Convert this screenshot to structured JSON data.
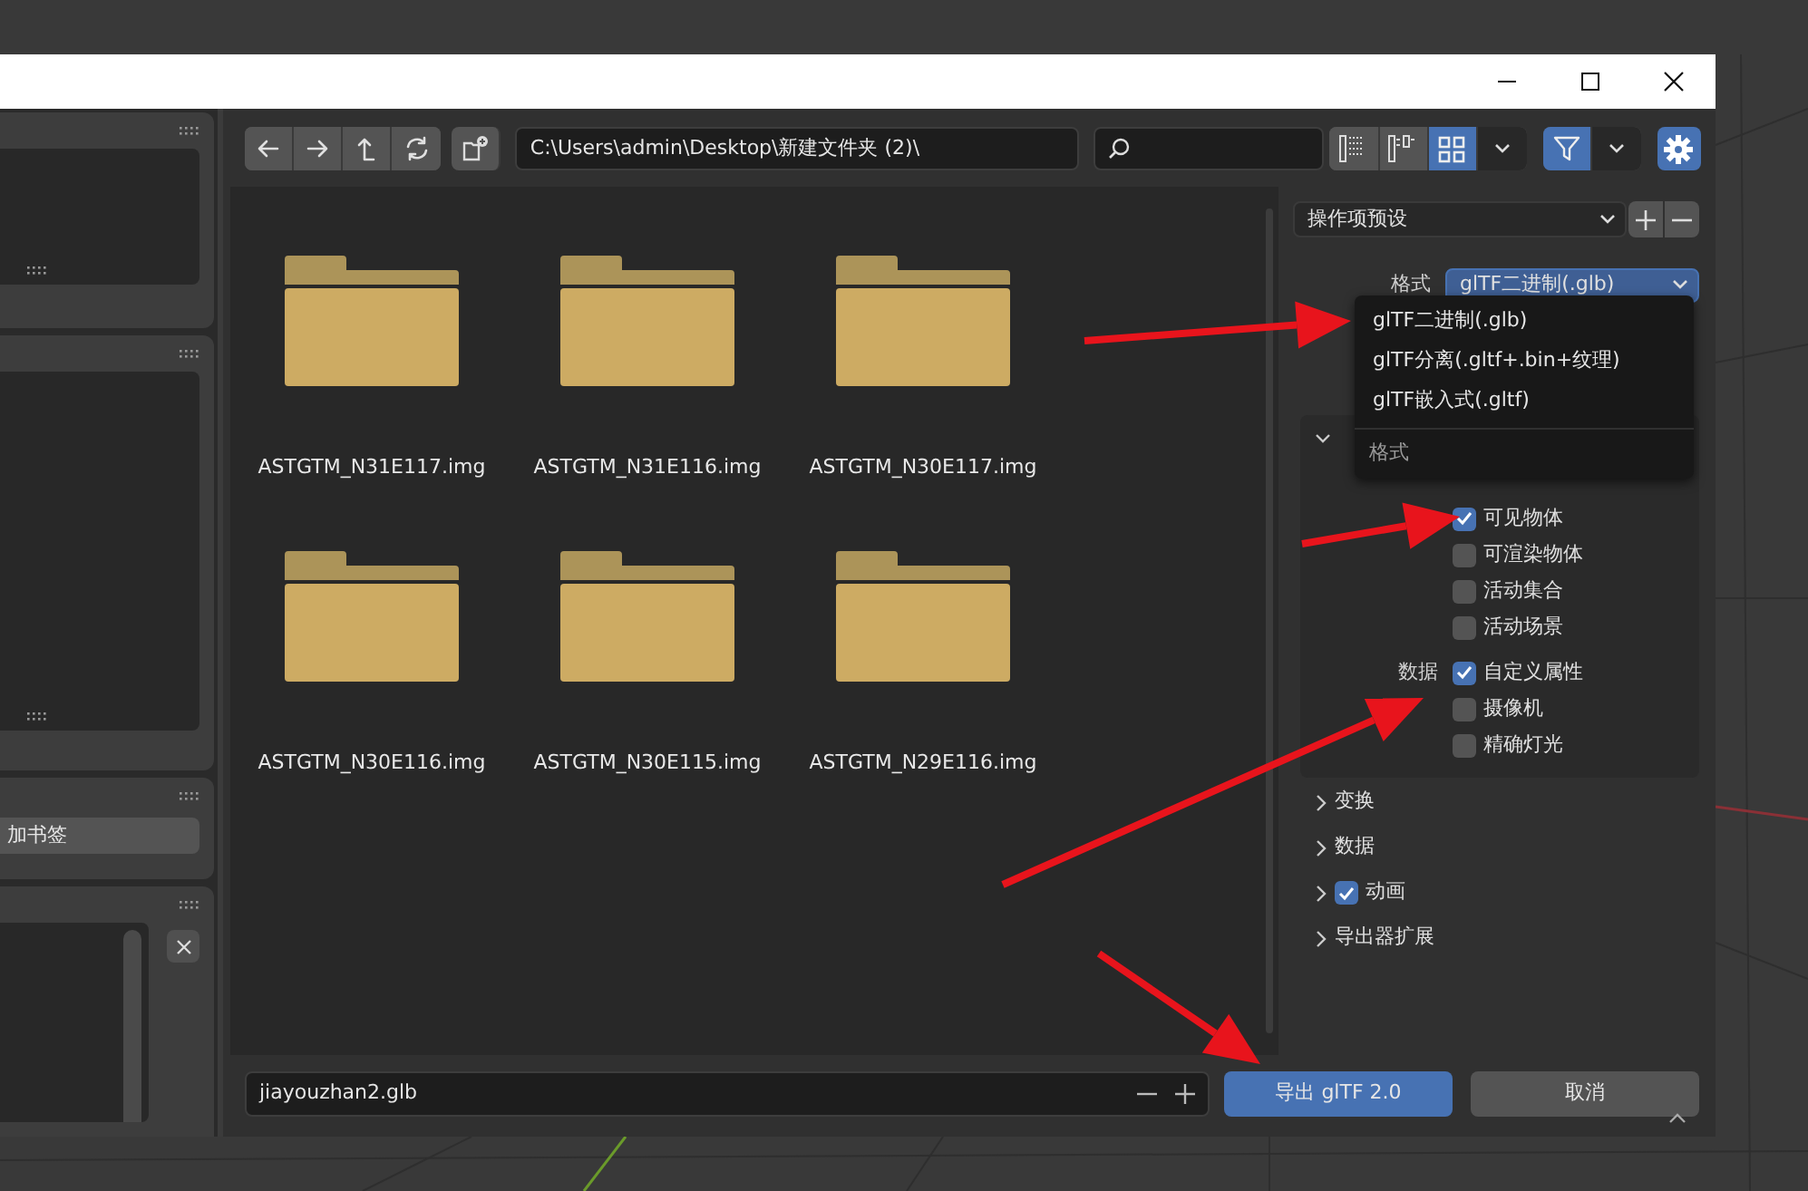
{
  "window": {
    "controls": [
      {
        "kind": "minimize"
      },
      {
        "kind": "maximize"
      },
      {
        "kind": "close"
      }
    ]
  },
  "sidebar": {
    "bookmark_button": "加书签"
  },
  "toolbar": {
    "nav_buttons": [
      {
        "kind": "back"
      },
      {
        "kind": "forward"
      },
      {
        "kind": "parent"
      },
      {
        "kind": "refresh"
      }
    ],
    "path": "C:\\Users\\admin\\Desktop\\新建文件夹 (2)\\",
    "display_modes": [
      {
        "kind": "vertical-list",
        "selected": false
      },
      {
        "kind": "horizontal-list",
        "selected": false
      },
      {
        "kind": "thumbnails",
        "selected": true
      }
    ],
    "filter": {
      "on": true
    }
  },
  "files": [
    {
      "name": "ASTGTM_N31E117.img"
    },
    {
      "name": "ASTGTM_N31E116.img"
    },
    {
      "name": "ASTGTM_N30E117.img"
    },
    {
      "name": "ASTGTM_N30E116.img"
    },
    {
      "name": "ASTGTM_N30E115.img"
    },
    {
      "name": "ASTGTM_N29E116.img"
    }
  ],
  "options_panel": {
    "preset": "操作项预设",
    "format_label": "格式",
    "format_value": "glTF二进制(.glb)",
    "format_menu": {
      "items": [
        "glTF二进制(.glb)",
        "glTF分离(.gltf+.bin+纹理)",
        "glTF嵌入式(.gltf)"
      ],
      "title": "格式"
    },
    "include": {
      "expanded": true,
      "groups": [
        {
          "options": [
            {
              "label": "可见物体",
              "checked": true
            },
            {
              "label": "可渲染物体",
              "checked": false
            },
            {
              "label": "活动集合",
              "checked": false
            },
            {
              "label": "活动场景",
              "checked": false
            }
          ]
        },
        {
          "label": "数据",
          "options": [
            {
              "label": "自定义属性",
              "checked": true
            },
            {
              "label": "摄像机",
              "checked": false
            },
            {
              "label": "精确灯光",
              "checked": false
            }
          ]
        }
      ]
    },
    "sections": [
      {
        "title": "变换",
        "expanded": false,
        "kind": "plain"
      },
      {
        "title": "数据",
        "expanded": false,
        "kind": "plain"
      },
      {
        "title": "动画",
        "expanded": false,
        "kind": "toggle",
        "checked": true
      },
      {
        "title": "导出器扩展",
        "expanded": false,
        "kind": "plain"
      }
    ]
  },
  "bottom_bar": {
    "filename": "jiayouzhan2.glb",
    "buttons": [
      {
        "label": "导出 glTF 2.0",
        "kind": "primary"
      },
      {
        "label": "取消",
        "kind": "secondary"
      }
    ]
  }
}
